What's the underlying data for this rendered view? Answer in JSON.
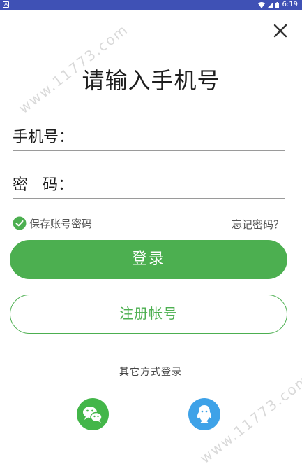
{
  "status_bar": {
    "time": "6:19",
    "left_icon": "notification-icon"
  },
  "header": {
    "title": "请输入手机号",
    "close_icon": "close-icon"
  },
  "form": {
    "phone_label": "手机号：",
    "password_label": "密   码：",
    "phone_value": "",
    "password_value": ""
  },
  "options": {
    "remember_label": "保存账号密码",
    "remember_checked": true,
    "forgot_label": "忘记密码？"
  },
  "buttons": {
    "login_label": "登录",
    "register_label": "注册帐号"
  },
  "divider": {
    "label": "其它方式登录"
  },
  "social": [
    {
      "name": "wechat",
      "icon": "wechat-icon"
    },
    {
      "name": "qq",
      "icon": "qq-icon"
    }
  ],
  "watermark": {
    "text": "www.11773.com"
  },
  "colors": {
    "accent": "#4caf50",
    "status_bar": "#3f51b5",
    "wechat": "#43b649",
    "qq": "#3ea2e8"
  }
}
